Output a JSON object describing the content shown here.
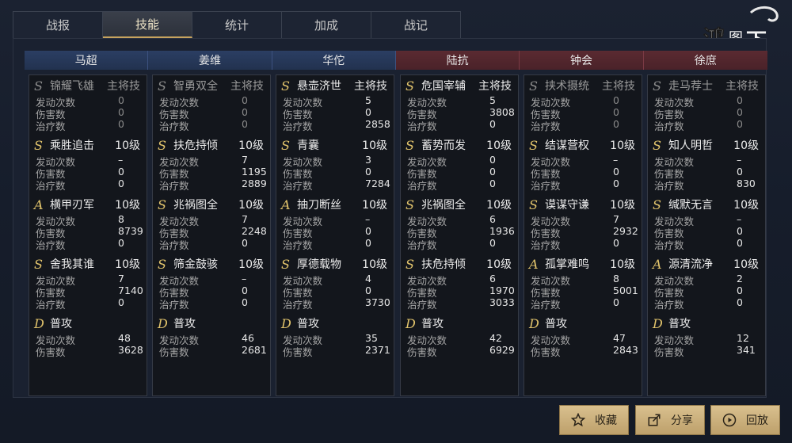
{
  "tabs": [
    "战报",
    "技能",
    "统计",
    "加成",
    "战记"
  ],
  "active_tab": 1,
  "logo_text": "鸿图之下",
  "teams": {
    "ally_color": "#2a3c60",
    "enemy_color": "#552830"
  },
  "generals": [
    {
      "name": "马超",
      "side": "ally",
      "skills": [
        {
          "grade": "S",
          "name": "锦耀飞雄",
          "level": "主将技",
          "dim": true,
          "stats": [
            [
              "发动次数",
              "0"
            ],
            [
              "伤害数",
              "0"
            ],
            [
              "治疗数",
              "0"
            ]
          ]
        },
        {
          "grade": "S",
          "name": "乘胜追击",
          "level": "10级",
          "stats": [
            [
              "发动次数",
              "–"
            ],
            [
              "伤害数",
              "0"
            ],
            [
              "治疗数",
              "0"
            ]
          ]
        },
        {
          "grade": "A",
          "name": "横甲刃军",
          "level": "10级",
          "stats": [
            [
              "发动次数",
              "8"
            ],
            [
              "伤害数",
              "8739"
            ],
            [
              "治疗数",
              "0"
            ]
          ]
        },
        {
          "grade": "S",
          "name": "舍我其谁",
          "level": "10级",
          "stats": [
            [
              "发动次数",
              "7"
            ],
            [
              "伤害数",
              "7140"
            ],
            [
              "治疗数",
              "0"
            ]
          ]
        },
        {
          "grade": "D",
          "name": "普攻",
          "level": "",
          "stats": [
            [
              "发动次数",
              "48"
            ],
            [
              "伤害数",
              "3628"
            ]
          ]
        }
      ]
    },
    {
      "name": "姜维",
      "side": "ally",
      "skills": [
        {
          "grade": "S",
          "name": "智勇双全",
          "level": "主将技",
          "dim": true,
          "stats": [
            [
              "发动次数",
              "0"
            ],
            [
              "伤害数",
              "0"
            ],
            [
              "治疗数",
              "0"
            ]
          ]
        },
        {
          "grade": "S",
          "name": "扶危持倾",
          "level": "10级",
          "stats": [
            [
              "发动次数",
              "7"
            ],
            [
              "伤害数",
              "1195"
            ],
            [
              "治疗数",
              "2889"
            ]
          ]
        },
        {
          "grade": "S",
          "name": "兆祸图全",
          "level": "10级",
          "stats": [
            [
              "发动次数",
              "7"
            ],
            [
              "伤害数",
              "2248"
            ],
            [
              "治疗数",
              "0"
            ]
          ]
        },
        {
          "grade": "S",
          "name": "筛金鼓骇",
          "level": "10级",
          "stats": [
            [
              "发动次数",
              "–"
            ],
            [
              "伤害数",
              "0"
            ],
            [
              "治疗数",
              "0"
            ]
          ]
        },
        {
          "grade": "D",
          "name": "普攻",
          "level": "",
          "stats": [
            [
              "发动次数",
              "46"
            ],
            [
              "伤害数",
              "2681"
            ]
          ]
        }
      ]
    },
    {
      "name": "华佗",
      "side": "ally",
      "skills": [
        {
          "grade": "S",
          "name": "悬壶济世",
          "level": "主将技",
          "dim": false,
          "stats": [
            [
              "发动次数",
              "5"
            ],
            [
              "伤害数",
              "0"
            ],
            [
              "治疗数",
              "2858"
            ]
          ]
        },
        {
          "grade": "S",
          "name": "青囊",
          "level": "10级",
          "stats": [
            [
              "发动次数",
              "3"
            ],
            [
              "伤害数",
              "0"
            ],
            [
              "治疗数",
              "7284"
            ]
          ]
        },
        {
          "grade": "A",
          "name": "抽刀断丝",
          "level": "10级",
          "stats": [
            [
              "发动次数",
              "–"
            ],
            [
              "伤害数",
              "0"
            ],
            [
              "治疗数",
              "0"
            ]
          ]
        },
        {
          "grade": "S",
          "name": "厚德载物",
          "level": "10级",
          "stats": [
            [
              "发动次数",
              "4"
            ],
            [
              "伤害数",
              "0"
            ],
            [
              "治疗数",
              "3730"
            ]
          ]
        },
        {
          "grade": "D",
          "name": "普攻",
          "level": "",
          "stats": [
            [
              "发动次数",
              "35"
            ],
            [
              "伤害数",
              "2371"
            ]
          ]
        }
      ]
    },
    {
      "name": "陆抗",
      "side": "enemy",
      "skills": [
        {
          "grade": "S",
          "name": "危国宰辅",
          "level": "主将技",
          "dim": false,
          "stats": [
            [
              "发动次数",
              "5"
            ],
            [
              "伤害数",
              "3808"
            ],
            [
              "治疗数",
              "0"
            ]
          ]
        },
        {
          "grade": "S",
          "name": "蓄势而发",
          "level": "10级",
          "stats": [
            [
              "发动次数",
              "0"
            ],
            [
              "伤害数",
              "0"
            ],
            [
              "治疗数",
              "0"
            ]
          ]
        },
        {
          "grade": "S",
          "name": "兆祸图全",
          "level": "10级",
          "stats": [
            [
              "发动次数",
              "6"
            ],
            [
              "伤害数",
              "1936"
            ],
            [
              "治疗数",
              "0"
            ]
          ]
        },
        {
          "grade": "S",
          "name": "扶危持倾",
          "level": "10级",
          "stats": [
            [
              "发动次数",
              "6"
            ],
            [
              "伤害数",
              "1970"
            ],
            [
              "治疗数",
              "3033"
            ]
          ]
        },
        {
          "grade": "D",
          "name": "普攻",
          "level": "",
          "stats": [
            [
              "发动次数",
              "42"
            ],
            [
              "伤害数",
              "6929"
            ]
          ]
        }
      ]
    },
    {
      "name": "钟会",
      "side": "enemy",
      "skills": [
        {
          "grade": "S",
          "name": "挟术摄统",
          "level": "主将技",
          "dim": true,
          "stats": [
            [
              "发动次数",
              "0"
            ],
            [
              "伤害数",
              "0"
            ],
            [
              "治疗数",
              "0"
            ]
          ]
        },
        {
          "grade": "S",
          "name": "结谋营权",
          "level": "10级",
          "stats": [
            [
              "发动次数",
              "–"
            ],
            [
              "伤害数",
              "0"
            ],
            [
              "治疗数",
              "0"
            ]
          ]
        },
        {
          "grade": "S",
          "name": "谟谋守谦",
          "level": "10级",
          "stats": [
            [
              "发动次数",
              "7"
            ],
            [
              "伤害数",
              "2932"
            ],
            [
              "治疗数",
              "0"
            ]
          ]
        },
        {
          "grade": "A",
          "name": "孤掌难鸣",
          "level": "10级",
          "stats": [
            [
              "发动次数",
              "8"
            ],
            [
              "伤害数",
              "5001"
            ],
            [
              "治疗数",
              "0"
            ]
          ]
        },
        {
          "grade": "D",
          "name": "普攻",
          "level": "",
          "stats": [
            [
              "发动次数",
              "47"
            ],
            [
              "伤害数",
              "2843"
            ]
          ]
        }
      ]
    },
    {
      "name": "徐庶",
      "side": "enemy",
      "skills": [
        {
          "grade": "S",
          "name": "走马荐士",
          "level": "主将技",
          "dim": true,
          "stats": [
            [
              "发动次数",
              "0"
            ],
            [
              "伤害数",
              "0"
            ],
            [
              "治疗数",
              "0"
            ]
          ]
        },
        {
          "grade": "S",
          "name": "知人明哲",
          "level": "10级",
          "stats": [
            [
              "发动次数",
              "–"
            ],
            [
              "伤害数",
              "0"
            ],
            [
              "治疗数",
              "830"
            ]
          ]
        },
        {
          "grade": "S",
          "name": "缄默无言",
          "level": "10级",
          "stats": [
            [
              "发动次数",
              "–"
            ],
            [
              "伤害数",
              "0"
            ],
            [
              "治疗数",
              "0"
            ]
          ]
        },
        {
          "grade": "A",
          "name": "源清流净",
          "level": "10级",
          "stats": [
            [
              "发动次数",
              "2"
            ],
            [
              "伤害数",
              "0"
            ],
            [
              "治疗数",
              "0"
            ]
          ]
        },
        {
          "grade": "D",
          "name": "普攻",
          "level": "",
          "stats": [
            [
              "发动次数",
              "12"
            ],
            [
              "伤害数",
              "341"
            ]
          ]
        }
      ]
    }
  ],
  "buttons": [
    {
      "label": "收藏",
      "icon": "star-icon"
    },
    {
      "label": "分享",
      "icon": "share-icon"
    },
    {
      "label": "回放",
      "icon": "play-icon"
    }
  ]
}
